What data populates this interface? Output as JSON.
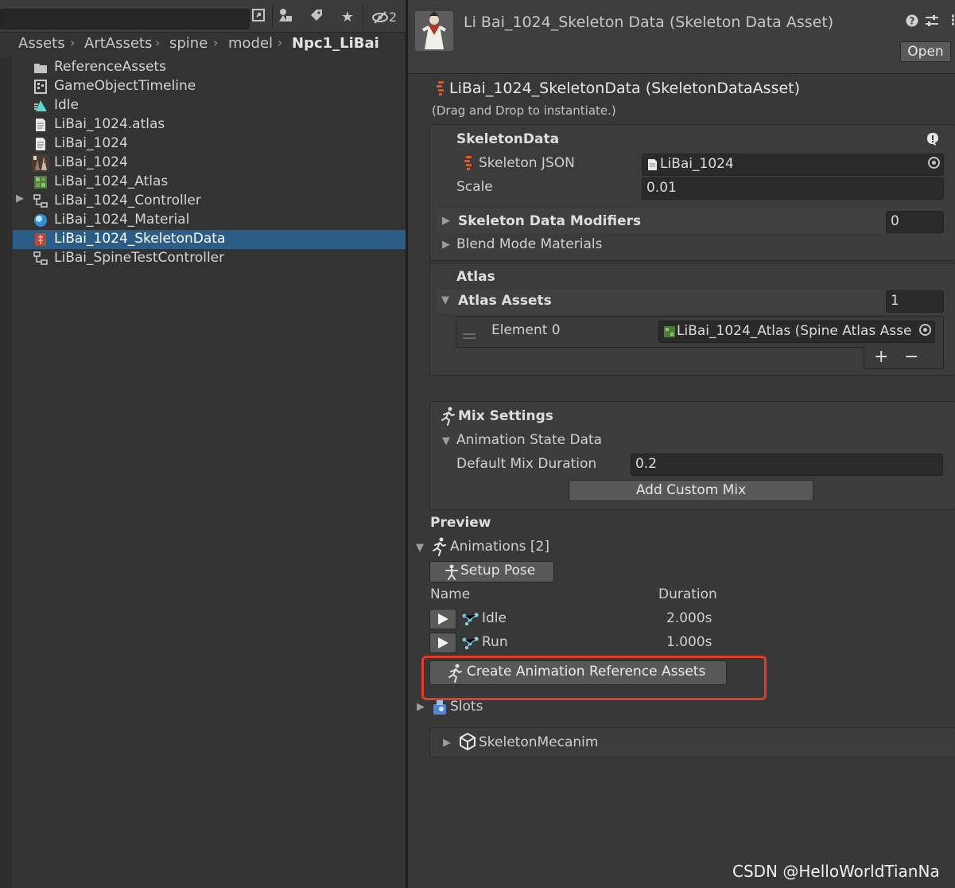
{
  "project": {
    "toolbar": {
      "hidden_count": "2"
    },
    "breadcrumb": [
      "Assets",
      "ArtAssets",
      "spine",
      "model",
      "Npc1_LiBai"
    ],
    "items": [
      {
        "label": "ReferenceAssets",
        "icon": "folder-icon"
      },
      {
        "label": "GameObjectTimeline",
        "icon": "timeline-icon"
      },
      {
        "label": "Idle",
        "icon": "animation-reference-icon"
      },
      {
        "label": "LiBai_1024.atlas",
        "icon": "text-file-icon"
      },
      {
        "label": "LiBai_1024",
        "icon": "text-file-icon"
      },
      {
        "label": "LiBai_1024",
        "icon": "texture-icon"
      },
      {
        "label": "LiBai_1024_Atlas",
        "icon": "atlas-icon"
      },
      {
        "label": "LiBai_1024_Controller",
        "icon": "animator-controller-icon"
      },
      {
        "label": "LiBai_1024_Material",
        "icon": "material-icon"
      },
      {
        "label": "LiBai_1024_SkeletonData",
        "icon": "skeleton-data-icon"
      },
      {
        "label": "LiBai_SpineTestController",
        "icon": "animator-controller-icon"
      }
    ],
    "selected_index": 9
  },
  "inspector": {
    "header_title": "Li Bai_1024_Skeleton Data (Skeleton Data Asset)",
    "open_label": "Open",
    "asset_title": "LiBai_1024_SkeletonData (SkeletonDataAsset)",
    "drag_hint": "(Drag and Drop to instantiate.)",
    "skeleton_data": {
      "heading": "SkeletonData",
      "json_label": "Skeleton JSON",
      "json_value": "LiBai_1024",
      "scale_label": "Scale",
      "scale_value": "0.01",
      "modifiers_label": "Skeleton Data Modifiers",
      "modifiers_count": "0",
      "blend_label": "Blend Mode Materials"
    },
    "atlas": {
      "heading": "Atlas",
      "assets_label": "Atlas Assets",
      "assets_count": "1",
      "element_label": "Element 0",
      "element_value": "LiBai_1024_Atlas (Spine Atlas Asse",
      "add": "+",
      "remove": "−"
    },
    "mix": {
      "heading": "Mix Settings",
      "state_label": "Animation State Data",
      "duration_label": "Default Mix Duration",
      "duration_value": "0.2",
      "add_custom_label": "Add Custom Mix"
    },
    "preview": {
      "heading": "Preview",
      "animations_label": "Animations [2]",
      "setup_pose_label": "Setup Pose",
      "col_name": "Name",
      "col_duration": "Duration",
      "animations": [
        {
          "name": "Idle",
          "duration": "2.000s"
        },
        {
          "name": "Run",
          "duration": "1.000s"
        }
      ],
      "create_ref_label": "Create Animation Reference Assets",
      "slots_label": "Slots",
      "mecanim_label": "SkeletonMecanim"
    }
  },
  "watermark": "CSDN @HelloWorldTianNa",
  "colors": {
    "selection": "#2c5d87",
    "highlight": "#e23a2a",
    "spine_orange": "#e0572a"
  }
}
